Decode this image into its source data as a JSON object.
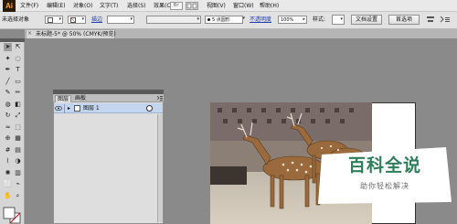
{
  "app": {
    "logo_text": "Ai",
    "bridge_label": "Br"
  },
  "menu": [
    "文件(F)",
    "编辑(E)",
    "对象(O)",
    "文字(T)",
    "选择(S)",
    "效果(C)",
    "视图(V)",
    "窗口(W)",
    "帮助(H)"
  ],
  "control_bar": {
    "selection_status": "未选择对象",
    "stroke_link": "描边",
    "brush_value": "5 点圆形",
    "opacity_link": "不透明度",
    "opacity_value": "100%",
    "style_label": "样式:",
    "doc_setup_button": "文档设置",
    "preferences_button": "首选项"
  },
  "document_tab": {
    "title": "未标题-5* @ 50% (CMYK/预览)",
    "close_glyph": "×"
  },
  "layers_panel": {
    "tabs": [
      "图层",
      "画板"
    ],
    "layers": [
      {
        "name": "图层 1"
      }
    ]
  },
  "watermark": {
    "title": "百科全说",
    "subtitle": "助你轻松解决"
  },
  "colors": {
    "menubar": "#e9e9e9",
    "toolbar": "#d6d6d6",
    "canvas": "#8a8a8a",
    "layer_selected": "#c3d5ee",
    "watermark_green": "#2f7d5a",
    "logo_bg": "#2b1a06",
    "logo_fg": "#f6a623"
  },
  "tools": [
    "selection-tool-icon",
    "direct-selection-tool-icon",
    "magic-wand-icon",
    "lasso-icon",
    "pen-tool-icon",
    "type-tool-icon",
    "line-tool-icon",
    "rectangle-tool-icon",
    "paintbrush-icon",
    "pencil-icon",
    "blob-brush-icon",
    "eraser-icon",
    "rotate-icon",
    "scale-icon",
    "width-tool-icon",
    "free-transform-icon",
    "shape-builder-icon",
    "perspective-grid-icon",
    "mesh-icon",
    "gradient-icon",
    "eyedropper-icon",
    "blend-icon",
    "symbol-sprayer-icon",
    "column-graph-icon",
    "artboard-tool-icon",
    "slice-tool-icon",
    "hand-tool-icon",
    "zoom-tool-icon"
  ]
}
